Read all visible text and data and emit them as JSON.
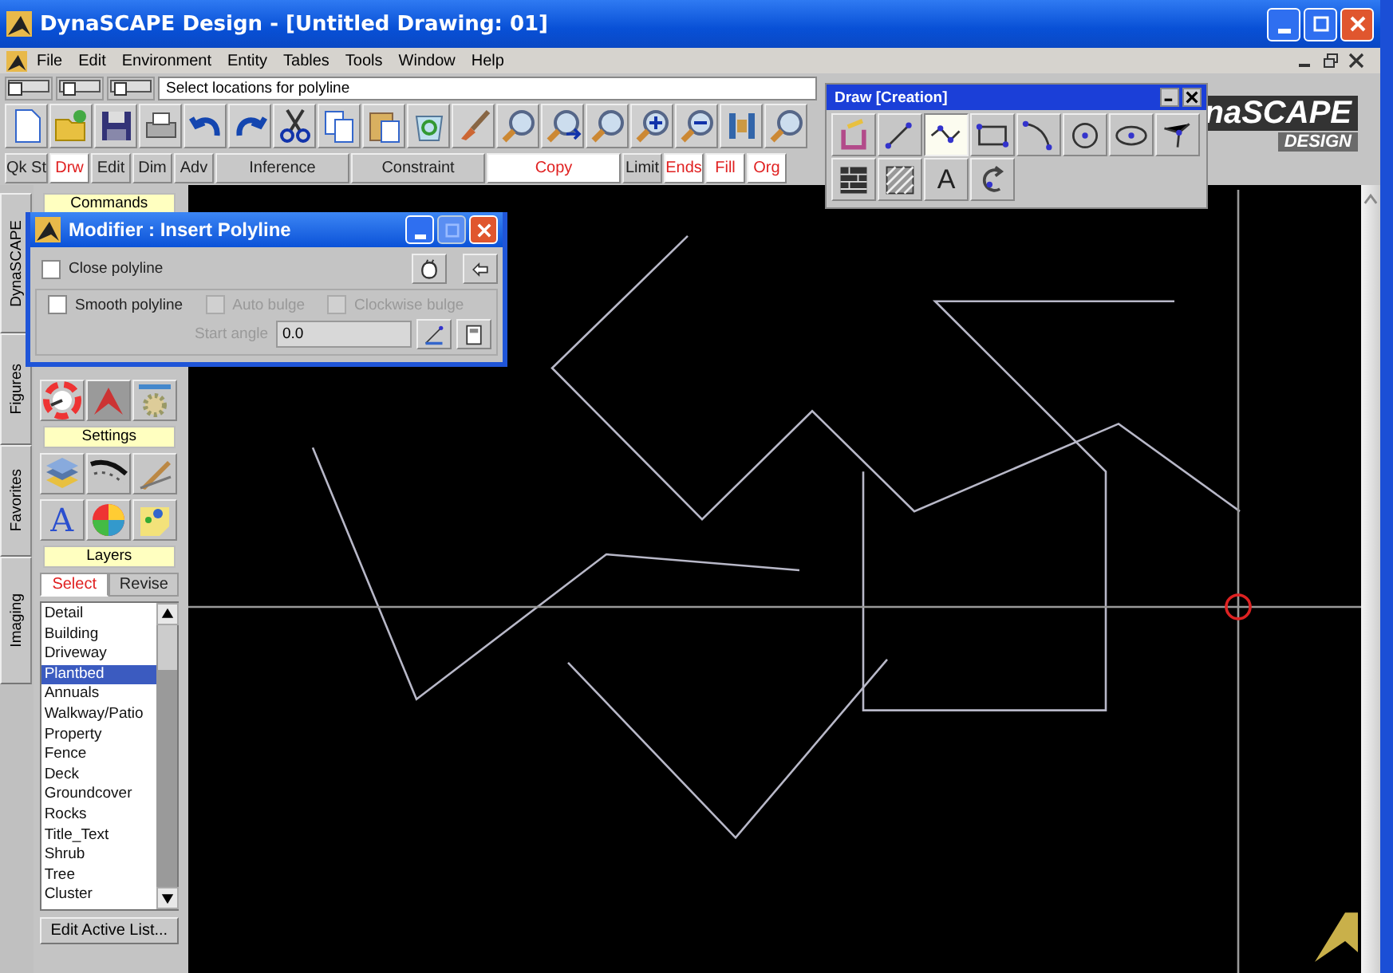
{
  "window": {
    "title": "DynaSCAPE Design  - [Untitled Drawing: 01]"
  },
  "menu": [
    "File",
    "Edit",
    "Environment",
    "Entity",
    "Tables",
    "Tools",
    "Window",
    "Help"
  ],
  "prompt": {
    "value": "Select locations for polyline"
  },
  "command_buttons": [
    {
      "label": "Qk St",
      "on": false
    },
    {
      "label": "Drw",
      "on": true
    },
    {
      "label": "Edit",
      "on": false
    },
    {
      "label": "Dim",
      "on": false
    },
    {
      "label": "Adv",
      "on": false
    },
    {
      "label": "Inference",
      "on": false
    },
    {
      "label": "Constraint",
      "on": false
    },
    {
      "label": "Copy",
      "on": true
    },
    {
      "label": "Limit",
      "on": false
    },
    {
      "label": "Ends",
      "on": true
    },
    {
      "label": "Fill",
      "on": true
    },
    {
      "label": "Org",
      "on": true
    }
  ],
  "logo": {
    "name": "naSCAPE",
    "subtitle": "DESIGN"
  },
  "side_tabs": [
    "DynaSCAPE",
    "Figures",
    "Favorites",
    "Imaging"
  ],
  "panel": {
    "sections": [
      "Commands",
      "Settings",
      "Layers"
    ],
    "text_style_glyph": "A"
  },
  "layer_tabs": [
    {
      "label": "Select",
      "selected": true
    },
    {
      "label": "Revise",
      "selected": false
    }
  ],
  "layers": [
    {
      "name": "Detail",
      "selected": false
    },
    {
      "name": "Building",
      "selected": false
    },
    {
      "name": "Driveway",
      "selected": false
    },
    {
      "name": "Plantbed",
      "selected": true
    },
    {
      "name": "Annuals",
      "selected": false
    },
    {
      "name": "Walkway/Patio",
      "selected": false
    },
    {
      "name": "Property",
      "selected": false
    },
    {
      "name": "Fence",
      "selected": false
    },
    {
      "name": "Deck",
      "selected": false
    },
    {
      "name": "Groundcover",
      "selected": false
    },
    {
      "name": "Rocks",
      "selected": false
    },
    {
      "name": "Title_Text",
      "selected": false
    },
    {
      "name": "Shrub",
      "selected": false
    },
    {
      "name": "Tree",
      "selected": false
    },
    {
      "name": "Cluster",
      "selected": false
    }
  ],
  "edit_list_button": "Edit Active List...",
  "modifier_dialog": {
    "title": "Modifier : Insert Polyline",
    "options": [
      {
        "label": "Close polyline",
        "checked": false,
        "disabled": false
      },
      {
        "label": "Smooth polyline",
        "checked": false,
        "disabled": false
      },
      {
        "label": "Auto bulge",
        "checked": false,
        "disabled": true
      },
      {
        "label": "Clockwise bulge",
        "checked": false,
        "disabled": true
      }
    ],
    "start_angle": {
      "label": "Start angle",
      "value": "0.0",
      "disabled": true
    }
  },
  "draw_toolbar": {
    "title": "Draw [Creation]",
    "tools": [
      {
        "selected": false
      },
      {
        "selected": false
      },
      {
        "selected": true
      },
      {
        "selected": false
      },
      {
        "selected": false
      },
      {
        "selected": false
      },
      {
        "selected": false
      },
      {
        "selected": false
      },
      {
        "selected": false
      },
      {
        "selected": false
      },
      {
        "selected": false,
        "glyph": "A"
      },
      {
        "selected": false
      }
    ]
  }
}
